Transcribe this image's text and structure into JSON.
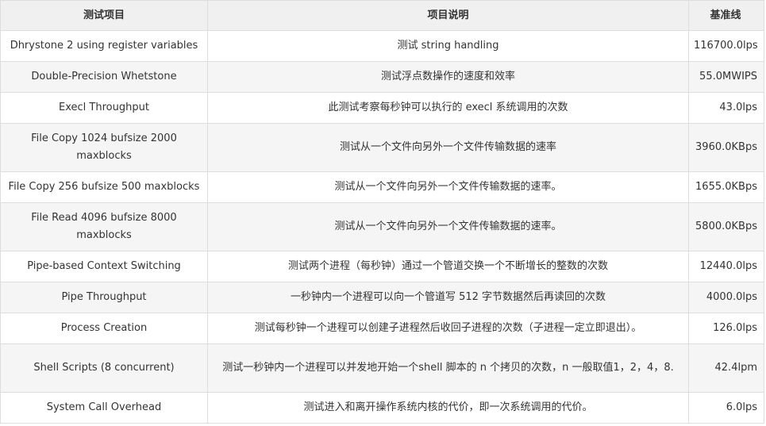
{
  "table": {
    "headers": [
      "测试项目",
      "项目说明",
      "基准线"
    ],
    "rows": [
      {
        "item": "Dhrystone 2 using register variables",
        "desc": "测试 string handling",
        "baseline": "116700.0lps"
      },
      {
        "item": "Double-Precision Whetstone",
        "desc": "测试浮点数操作的速度和效率",
        "baseline": "55.0MWIPS"
      },
      {
        "item": "Execl Throughput",
        "desc": "此测试考察每秒钟可以执行的 execl 系统调用的次数",
        "baseline": "43.0lps"
      },
      {
        "item": "File Copy 1024 bufsize 2000 maxblocks",
        "desc": "测试从一个文件向另外一个文件传输数据的速率",
        "baseline": "3960.0KBps"
      },
      {
        "item": "File Copy 256 bufsize 500 maxblocks",
        "desc": "测试从一个文件向另外一个文件传输数据的速率。",
        "baseline": "1655.0KBps"
      },
      {
        "item": "File Read 4096 bufsize 8000 maxblocks",
        "desc": "测试从一个文件向另外一个文件传输数据的速率。",
        "baseline": "5800.0KBps"
      },
      {
        "item": "Pipe-based Context Switching",
        "desc": "测试两个进程（每秒钟）通过一个管道交换一个不断增长的整数的次数",
        "baseline": "12440.0lps"
      },
      {
        "item": "Pipe Throughput",
        "desc": "一秒钟内一个进程可以向一个管道写 512 字节数据然后再读回的次数",
        "baseline": "4000.0lps"
      },
      {
        "item": "Process Creation",
        "desc": "测试每秒钟一个进程可以创建子进程然后收回子进程的次数（子进程一定立即退出）。",
        "baseline": "126.0lps"
      },
      {
        "item": "Shell Scripts (8 concurrent)",
        "desc": "测试一秒钟内一个进程可以并发地开始一个shell 脚本的 n 个拷贝的次数，n 一般取值1，2，4，8.",
        "baseline": "42.4lpm"
      },
      {
        "item": "System Call Overhead",
        "desc": "测试进入和离开操作系统内核的代价，即一次系统调用的代价。",
        "baseline": "6.0lps"
      }
    ]
  }
}
